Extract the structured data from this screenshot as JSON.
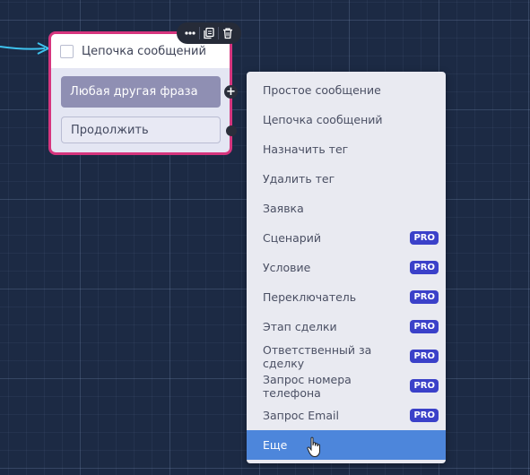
{
  "node": {
    "title": "Цепочка сообщений",
    "buttons": [
      {
        "label": "Любая другая фраза",
        "style": "filled"
      },
      {
        "label": "Продолжить",
        "style": "outline"
      }
    ],
    "toolbar_icons": [
      "more-icon",
      "copy-icon",
      "trash-icon"
    ]
  },
  "menu": {
    "items": [
      {
        "label": "Простое сообщение",
        "badge": ""
      },
      {
        "label": "Цепочка сообщений",
        "badge": ""
      },
      {
        "label": "Назначить тег",
        "badge": ""
      },
      {
        "label": "Удалить тег",
        "badge": ""
      },
      {
        "label": "Заявка",
        "badge": ""
      },
      {
        "label": "Сценарий",
        "badge": "PRO"
      },
      {
        "label": "Условие",
        "badge": "PRO"
      },
      {
        "label": "Переключатель",
        "badge": "PRO"
      },
      {
        "label": "Этап сделки",
        "badge": "PRO"
      },
      {
        "label": "Ответственный за сделку",
        "badge": "PRO"
      },
      {
        "label": "Запрос номера телефона",
        "badge": "PRO"
      },
      {
        "label": "Запрос Email",
        "badge": "PRO"
      },
      {
        "label": "Еще",
        "badge": "",
        "active": true
      }
    ]
  },
  "colors": {
    "canvas_bg": "#1c2a44",
    "node_border": "#d6357e",
    "connector": "#3ec3ef",
    "pro_badge": "#3b41c9",
    "active_item": "#4d86db"
  }
}
